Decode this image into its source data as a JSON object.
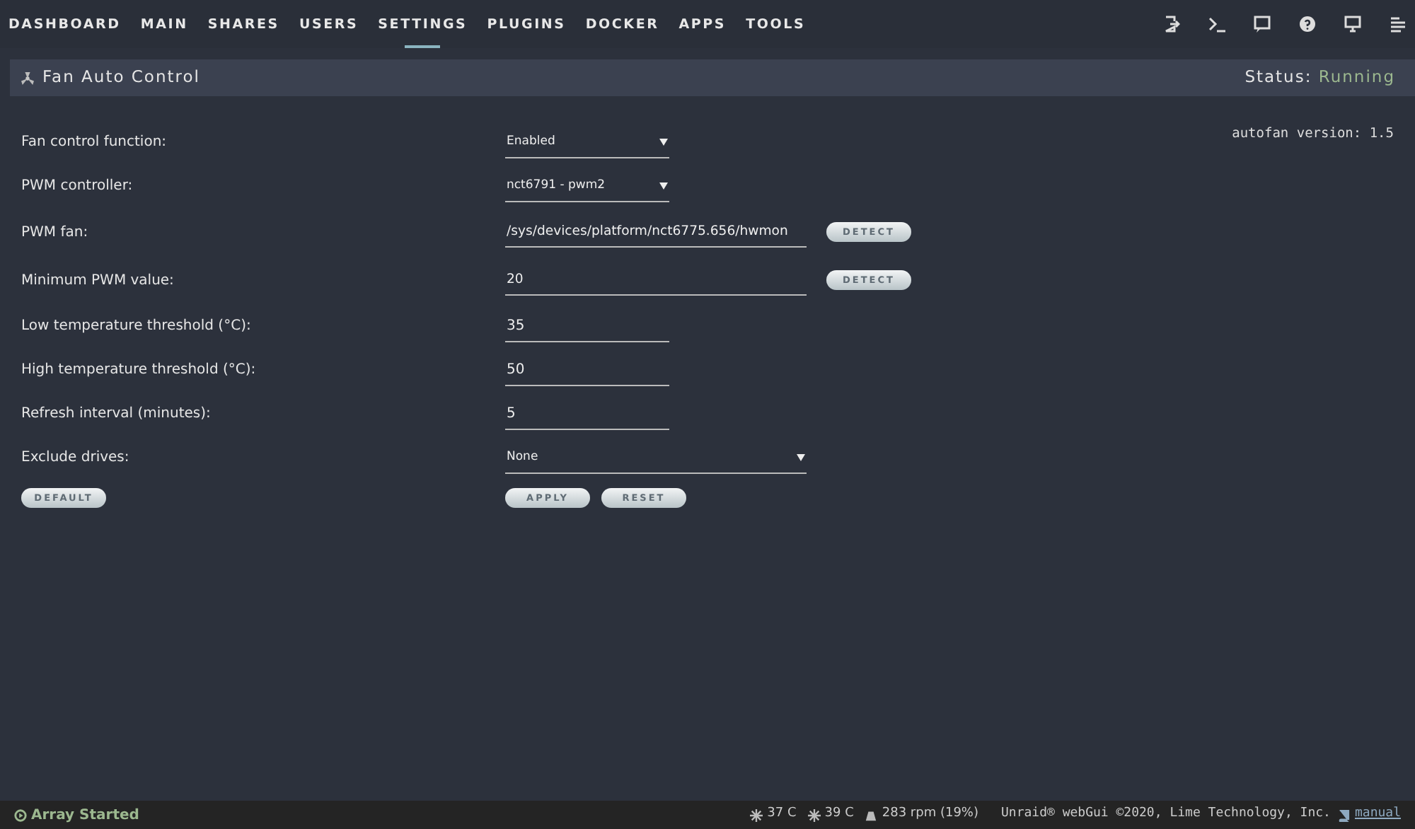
{
  "nav": {
    "tabs": [
      {
        "label": "DASHBOARD",
        "selected": false
      },
      {
        "label": "MAIN",
        "selected": false
      },
      {
        "label": "SHARES",
        "selected": false
      },
      {
        "label": "USERS",
        "selected": false
      },
      {
        "label": "SETTINGS",
        "selected": true
      },
      {
        "label": "PLUGINS",
        "selected": false
      },
      {
        "label": "DOCKER",
        "selected": false
      },
      {
        "label": "APPS",
        "selected": false
      },
      {
        "label": "TOOLS",
        "selected": false
      }
    ],
    "icons": [
      {
        "kind": "logout"
      },
      {
        "kind": "terminal"
      },
      {
        "kind": "feedback"
      },
      {
        "kind": "help"
      },
      {
        "kind": "monitor"
      },
      {
        "kind": "log"
      }
    ]
  },
  "panel": {
    "title": "Fan Auto Control",
    "status_label": "Status:",
    "status_value": "Running"
  },
  "version": "autofan version: 1.5",
  "rows": [
    {
      "label": "Fan control function:",
      "kind": "select",
      "value": "Enabled"
    },
    {
      "label": "PWM controller:",
      "kind": "select",
      "value": "nct6791 - pwm2"
    },
    {
      "label": "PWM fan:",
      "kind": "wide_input",
      "value": "/sys/devices/platform/nct6775.656/hwmon",
      "button": "DETECT"
    },
    {
      "label": "Minimum PWM value:",
      "kind": "wide_input",
      "value": "20",
      "button": "DETECT"
    },
    {
      "label": "Low temperature threshold (°C):",
      "kind": "input",
      "value": "35"
    },
    {
      "label": "High temperature threshold (°C):",
      "kind": "input",
      "value": "50"
    },
    {
      "label": "Refresh interval (minutes):",
      "kind": "input",
      "value": "5"
    },
    {
      "label": "Exclude drives:",
      "kind": "wide_select",
      "value": "None"
    }
  ],
  "left_button": "DEFAULT",
  "buttons": [
    "APPLY",
    "RESET"
  ],
  "footer": {
    "array_status": "Array Started",
    "temps": [
      "37 C",
      "39 C"
    ],
    "fan": "283 rpm (19%)",
    "copyright": "Unraid® webGui ©2020, Lime Technology, Inc.",
    "manual": "manual"
  }
}
